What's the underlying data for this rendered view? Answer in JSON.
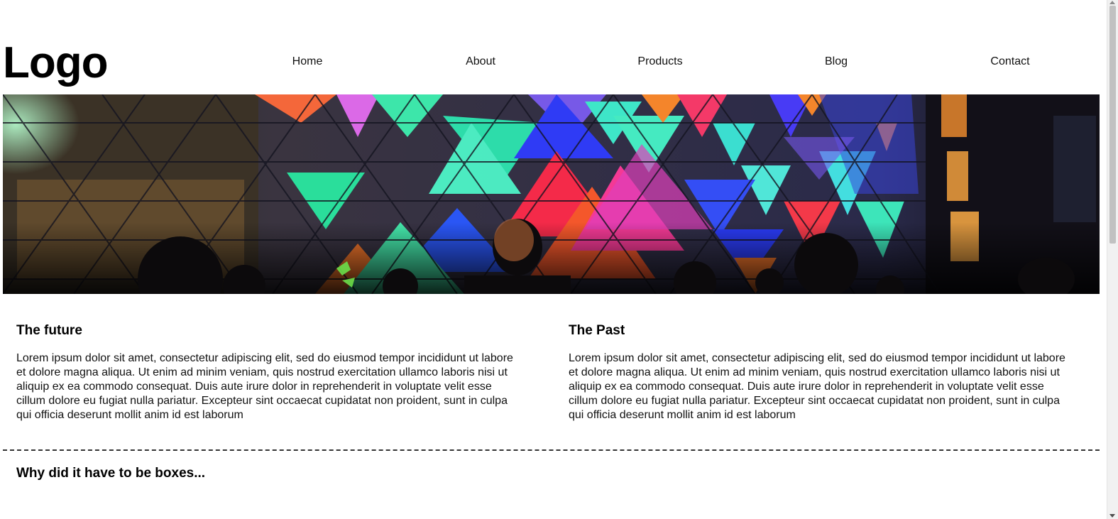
{
  "header": {
    "logo": "Logo",
    "nav": [
      "Home",
      "About",
      "Products",
      "Blog",
      "Contact"
    ]
  },
  "hero": {
    "alt": "hero-image"
  },
  "columns": [
    {
      "title": "The future",
      "body": "Lorem ipsum dolor sit amet, consectetur adipiscing elit, sed do eiusmod tempor incididunt ut labore et dolore magna aliqua. Ut enim ad minim veniam, quis nostrud exercitation ullamco laboris nisi ut aliquip ex ea commodo consequat. Duis aute irure dolor in reprehenderit in voluptate velit esse cillum dolore eu fugiat nulla pariatur. Excepteur sint occaecat cupidatat non proident, sunt in culpa qui officia deserunt mollit anim id est laborum"
    },
    {
      "title": "The Past",
      "body": "Lorem ipsum dolor sit amet, consectetur adipiscing elit, sed do eiusmod tempor incididunt ut labore et dolore magna aliqua. Ut enim ad minim veniam, quis nostrud exercitation ullamco laboris nisi ut aliquip ex ea commodo consequat. Duis aute irure dolor in reprehenderit in voluptate velit esse cillum dolore eu fugiat nulla pariatur. Excepteur sint occaecat cupidatat non proident, sunt in culpa qui officia deserunt mollit anim id est laborum"
    }
  ],
  "section": {
    "title": "Why did it have to be boxes..."
  },
  "colors": {
    "text": "#111111",
    "background": "#ffffff"
  }
}
